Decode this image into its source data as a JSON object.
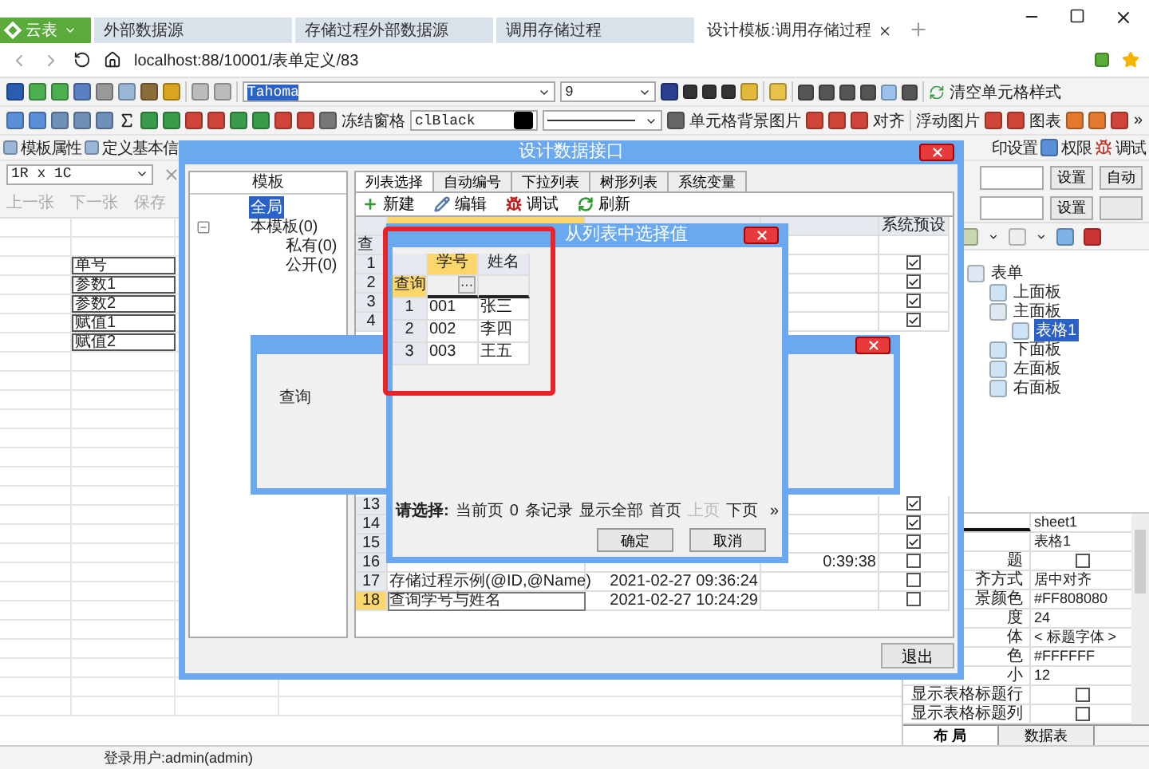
{
  "browser": {
    "app_button": "云表",
    "tabs": [
      {
        "label": "外部数据源",
        "selected": false
      },
      {
        "label": "存储过程外部数据源",
        "selected": false
      },
      {
        "label": "调用存储过程",
        "selected": false
      },
      {
        "label": "设计模板:调用存储过程",
        "selected": true
      }
    ],
    "url": "localhost:88/10001/表单定义/83"
  },
  "toolbar": {
    "font": "Tahoma",
    "size": "9",
    "clear_style": "清空单元格样式",
    "freeze": "冻结窗格",
    "color_name": "clBlack",
    "cell_bg_image": "单元格背景图片",
    "align": "对齐",
    "float_image": "浮动图片",
    "chart": "图表",
    "more": "»",
    "template_props": "模板属性",
    "define_basic": "定义基本信",
    "print_settings": "印设置",
    "permissions": "权限",
    "debug": "调试"
  },
  "sheet": {
    "cell_ref": "1R x 1C",
    "nav": [
      {
        "label": "上一张",
        "disabled": true
      },
      {
        "label": "下一张",
        "disabled": true
      },
      {
        "label": "保存",
        "disabled": true
      }
    ],
    "cells": [
      "单号",
      "参数1",
      "参数2",
      "赋值1",
      "赋值2"
    ]
  },
  "right_panel": {
    "fields": [
      {
        "button": "设置",
        "extra": "自动"
      },
      {
        "button": "设置"
      }
    ],
    "tree": [
      {
        "label": "表单",
        "children": [
          {
            "label": "上面板",
            "selected": false
          },
          {
            "label": "主面板",
            "selected": false,
            "children": [
              {
                "label": "表格1",
                "selected": true
              }
            ]
          },
          {
            "label": "下面板",
            "selected": false
          },
          {
            "label": "左面板",
            "selected": false
          },
          {
            "label": "右面板",
            "selected": false
          }
        ]
      }
    ],
    "properties": [
      {
        "kind": "text",
        "value": "sheet1"
      },
      {
        "kind": "text",
        "value": "表格1"
      },
      {
        "kind": "checkbox",
        "label": "题",
        "checked": false
      },
      {
        "kind": "text",
        "label": "齐方式",
        "value": "居中对齐"
      },
      {
        "kind": "text",
        "label": "景颜色",
        "value": "#FF808080"
      },
      {
        "kind": "text",
        "label": "度",
        "value": "24"
      },
      {
        "kind": "text",
        "label": "体",
        "value": "< 标题字体 >"
      },
      {
        "kind": "text",
        "label": "色",
        "value": "#FFFFFF"
      },
      {
        "kind": "text",
        "label": "小",
        "value": "12"
      },
      {
        "kind": "checkbox",
        "label": "显示表格标题行",
        "checked": false
      },
      {
        "kind": "checkbox",
        "label": "显示表格标题列",
        "checked": false
      }
    ],
    "tabs": [
      {
        "label": "布 局",
        "selected": true
      },
      {
        "label": "数据表",
        "selected": false
      }
    ]
  },
  "design_dialog": {
    "title": "设计数据接口",
    "tree_header": "模板",
    "tree": [
      {
        "label": "全局",
        "selected": true
      },
      {
        "label": "本模板(0)",
        "selected": false,
        "expanded": true,
        "children": [
          {
            "label": "私有(0)",
            "selected": false
          },
          {
            "label": "公开(0)",
            "selected": false
          }
        ]
      }
    ],
    "tabs": [
      {
        "label": "列表选择",
        "selected": true
      },
      {
        "label": "自动编号",
        "selected": false
      },
      {
        "label": "下拉列表",
        "selected": false
      },
      {
        "label": "树形列表",
        "selected": false
      },
      {
        "label": "系统变量",
        "selected": false
      }
    ],
    "actions": [
      "新建",
      "编辑",
      "调试",
      "刷新"
    ],
    "grid": {
      "column_4": "系统预设",
      "query_label": "查",
      "rows_top": [
        {
          "number": "1",
          "preset": true,
          "selected": false
        },
        {
          "number": "2",
          "preset": true,
          "selected": false
        },
        {
          "number": "3",
          "preset": true,
          "selected": false
        },
        {
          "number": "4",
          "preset": true,
          "selected": false
        }
      ],
      "rows_bottom": [
        {
          "number": "13",
          "preset": true,
          "selected": false
        },
        {
          "number": "14",
          "preset": true,
          "selected": false
        },
        {
          "number": "15",
          "preset": true,
          "selected": false
        },
        {
          "number": "16",
          "column_3": "0:39:38",
          "preset": false,
          "selected": false
        },
        {
          "number": "17",
          "column_1": "存储过程示例(@ID,@Name)",
          "column_2": "2021-02-27 09:36:24",
          "preset": false,
          "selected": false
        },
        {
          "number": "18",
          "column_1": "查询学号与姓名",
          "column_2": "2021-02-27 10:24:29",
          "preset": false,
          "selected": true
        }
      ]
    },
    "exit": "退出"
  },
  "query_dialog": {
    "label": "查询"
  },
  "select_dialog": {
    "title": "从列表中选择值",
    "columns": [
      {
        "label": "学号",
        "selected": true
      },
      {
        "label": "姓名",
        "selected": false
      }
    ],
    "query_label": "查询",
    "ellipsis": "···",
    "rows": [
      {
        "number": "1",
        "values": [
          "001",
          "张三"
        ]
      },
      {
        "number": "2",
        "values": [
          "002",
          "李四"
        ]
      },
      {
        "number": "3",
        "values": [
          "003",
          "王五"
        ]
      }
    ],
    "pager": {
      "prompt": "请选择:",
      "items": [
        {
          "label": "当前页",
          "disabled": false
        },
        {
          "label": "0",
          "disabled": false
        },
        {
          "label": "条记录",
          "disabled": false
        },
        {
          "label": "显示全部",
          "disabled": false
        },
        {
          "label": "首页",
          "disabled": false
        },
        {
          "label": "上页",
          "disabled": true
        },
        {
          "label": "下页",
          "disabled": false
        }
      ],
      "more": "»"
    },
    "buttons": [
      "确定",
      "取消"
    ]
  },
  "status_bar": {
    "user": "登录用户:admin(admin)"
  }
}
